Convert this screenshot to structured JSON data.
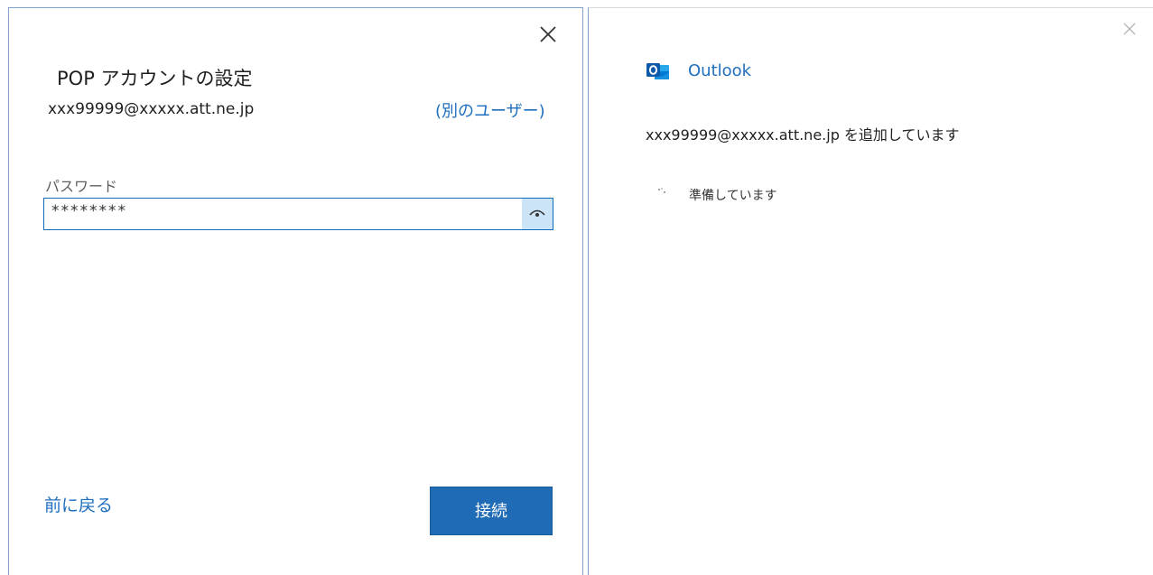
{
  "setup_dialog": {
    "title": "POP アカウントの設定",
    "email": "xxx99999@xxxxx.att.ne.jp",
    "switch_user_link": "(別のユーザー)",
    "password_label": "パスワード",
    "password_value": "********",
    "back_link": "前に戻る",
    "connect_button": "接続",
    "close_icon": "close-icon",
    "reveal_icon": "eye-icon"
  },
  "progress_panel": {
    "app_name": "Outlook",
    "adding_message": "xxx99999@xxxxx.att.ne.jp を追加しています",
    "status": "準備しています",
    "close_icon": "close-icon",
    "spinner_icon": "spinner-icon",
    "logo_icon": "outlook-logo-icon"
  },
  "colors": {
    "accent": "#1f6fbf",
    "primary_button": "#1f6bb5",
    "input_border": "#0f6cbd",
    "reveal_button_bg": "#cce4f7"
  }
}
